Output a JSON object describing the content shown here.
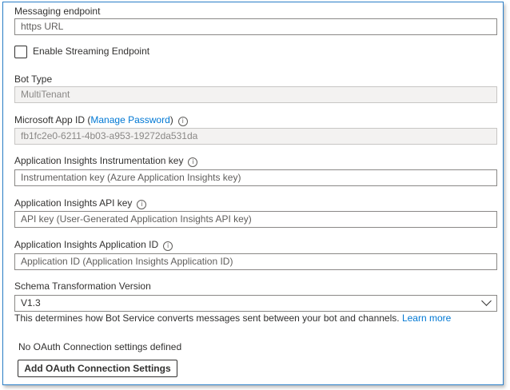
{
  "messaging_endpoint": {
    "label": "Messaging endpoint",
    "placeholder": "https URL"
  },
  "streaming": {
    "label": "Enable Streaming Endpoint",
    "checked": false
  },
  "bot_type": {
    "label": "Bot Type",
    "value": "MultiTenant"
  },
  "app_id": {
    "label_prefix": "Microsoft App ID (",
    "link": "Manage Password",
    "label_suffix": ")",
    "info_icon": "i",
    "value": "fb1fc2e0-6211-4b03-a953-19272da531da"
  },
  "instrumentation_key": {
    "label": "Application Insights Instrumentation key",
    "info_icon": "i",
    "placeholder": "Instrumentation key (Azure Application Insights key)"
  },
  "api_key": {
    "label": "Application Insights API key",
    "info_icon": "i",
    "placeholder": "API key (User-Generated Application Insights API key)"
  },
  "application_id": {
    "label": "Application Insights Application ID",
    "info_icon": "i",
    "placeholder": "Application ID (Application Insights Application ID)"
  },
  "schema": {
    "label": "Schema Transformation Version",
    "value": "V1.3",
    "help_text": "This determines how Bot Service converts messages sent between your bot and channels.",
    "help_link": "Learn more"
  },
  "oauth": {
    "status": "No OAuth Connection settings defined",
    "button_label": "Add OAuth Connection Settings"
  },
  "colors": {
    "accent": "#0078d4",
    "frame_border": "#2b7fc8"
  }
}
